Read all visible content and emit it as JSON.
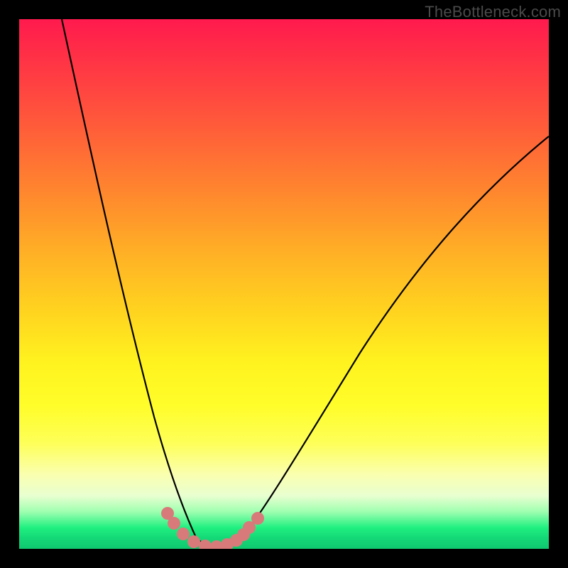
{
  "watermark": "TheBottleneck.com",
  "chart_data": {
    "type": "line",
    "title": "",
    "xlabel": "",
    "ylabel": "",
    "xlim": [
      0,
      100
    ],
    "ylim": [
      0,
      100
    ],
    "series": [
      {
        "name": "left-curve",
        "x": [
          8,
          10,
          12,
          14,
          16,
          18,
          20,
          22,
          24,
          26,
          28,
          30,
          32,
          33
        ],
        "y": [
          100,
          84,
          70,
          58,
          47,
          37,
          28,
          21,
          15,
          10,
          6,
          3,
          1,
          0
        ]
      },
      {
        "name": "right-curve",
        "x": [
          42,
          46,
          50,
          55,
          60,
          65,
          70,
          75,
          80,
          85,
          90,
          95,
          100
        ],
        "y": [
          0,
          2,
          5,
          10,
          16,
          23,
          31,
          39,
          47,
          56,
          64,
          72,
          78
        ]
      },
      {
        "name": "valley-floor",
        "x": [
          33,
          36,
          39,
          42
        ],
        "y": [
          0,
          0,
          0,
          0
        ]
      }
    ],
    "marker_points": {
      "name": "highlight-dots",
      "x": [
        28,
        29,
        31,
        33,
        35,
        37,
        39,
        41,
        42,
        43,
        45
      ],
      "y": [
        6.5,
        4.5,
        2.5,
        1,
        0.5,
        0.5,
        0.7,
        1.2,
        2,
        3.2,
        5
      ]
    },
    "colors": {
      "curve": "#000000",
      "marker": "#d97a7a"
    }
  }
}
